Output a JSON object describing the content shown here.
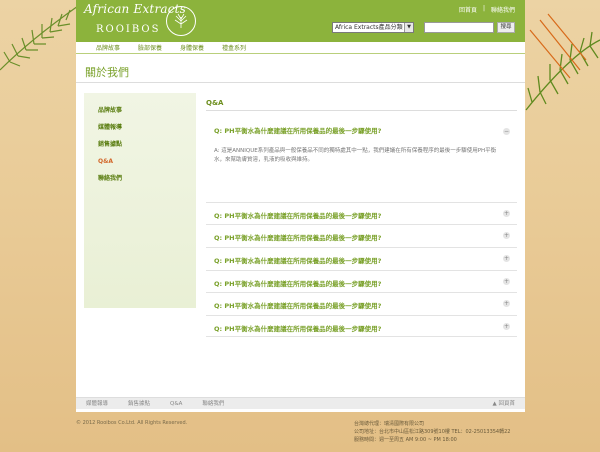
{
  "header": {
    "logo_script": "African Extracts",
    "logo_word": "ROOIBOS",
    "top_links": [
      "回首頁",
      "聯絡我們"
    ],
    "select_value": "Africa Extracts產品分類",
    "search_placeholder": "",
    "search_button": "搜尋"
  },
  "nav": {
    "items": [
      "品牌故事",
      "臉部保養",
      "身體保養",
      "禮盒系列"
    ]
  },
  "page_title": "關於我們",
  "sidebar": {
    "items": [
      "品牌故事",
      "媒體報導",
      "銷售據點",
      "Q&A",
      "聯絡我們"
    ],
    "active_index": 3
  },
  "content": {
    "title": "Q&A",
    "faq": [
      {
        "question": "Q: PH平衡水為什麼建議在所用保養品的最後一步驟使用?",
        "answer": "A: 這是ANNIQUE系列產品與一般保養品不同的獨特處其中一點，我們建議在所有保養程序的最後一步驟使用PH平衡水，來幫助膚質溶，乳液的吸收與維持。",
        "expanded": true,
        "toggle": "−"
      },
      {
        "question": "Q: PH平衡水為什麼建議在所用保養品的最後一步驟使用?",
        "toggle": "+"
      },
      {
        "question": "Q: PH平衡水為什麼建議在所用保養品的最後一步驟使用?",
        "toggle": "+"
      },
      {
        "question": "Q: PH平衡水為什麼建議在所用保養品的最後一步驟使用?",
        "toggle": "+"
      },
      {
        "question": "Q: PH平衡水為什麼建議在所用保養品的最後一步驟使用?",
        "toggle": "+"
      },
      {
        "question": "Q: PH平衡水為什麼建議在所用保養品的最後一步驟使用?",
        "toggle": "+"
      },
      {
        "question": "Q: PH平衡水為什麼建議在所用保養品的最後一步驟使用?",
        "toggle": "+"
      }
    ]
  },
  "footer": {
    "links": [
      "媒體報導",
      "銷售據點",
      "Q&A",
      "聯絡我們"
    ],
    "back_label": "▲ 回頁首",
    "copyright": "© 2012  Rooibos Co.Ltd. All Rights Reserved.",
    "company_lines": [
      "台灣總代理：瑞清國際有限公司",
      "公司地址：台北市中山區松江路309號10樓    TEL：02-25013354轉22",
      "服務時間：週一至周五 AM 9:00 ~ PM 18:00"
    ]
  },
  "colors": {
    "brand_green": "#8cb33c",
    "link_green": "#7aa12a",
    "active_orange": "#d2672a",
    "sand": "#e9cb97"
  }
}
